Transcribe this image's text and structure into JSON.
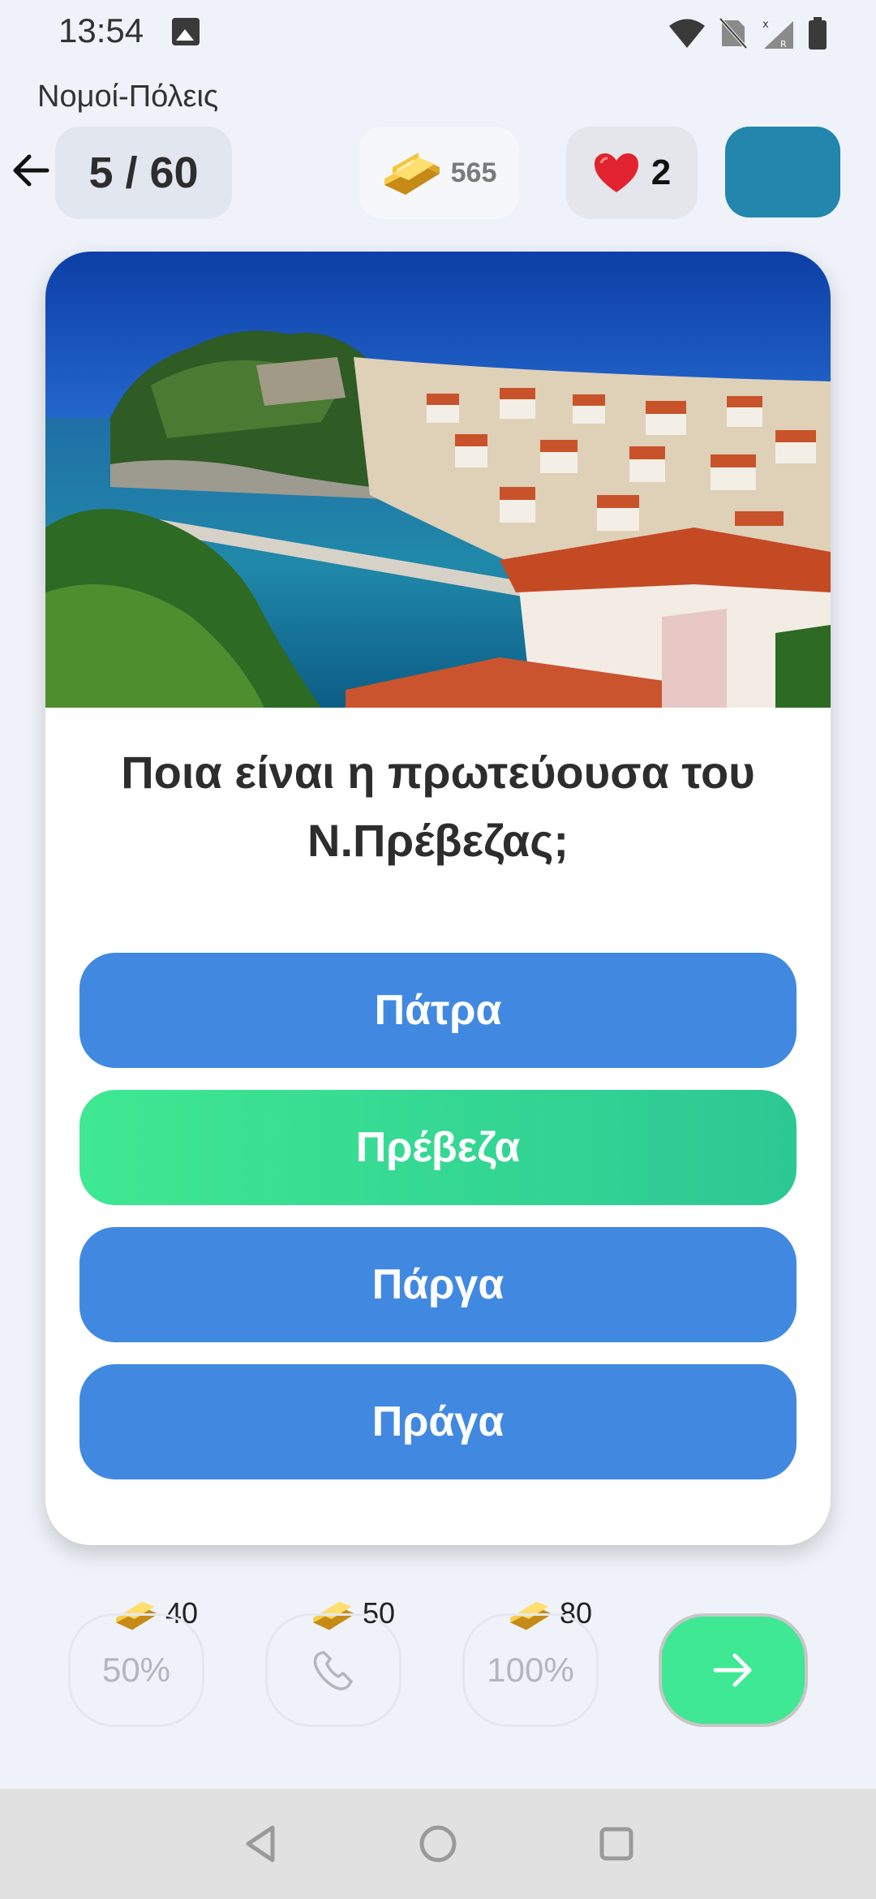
{
  "status_bar": {
    "time": "13:54"
  },
  "header": {
    "subtitle": "Νομοί-Πόλεις",
    "progress": "5 / 60",
    "coins": "565",
    "lives": "2"
  },
  "question": {
    "text": "Ποια είναι η πρωτεύουσα του Ν.Πρέβεζας;"
  },
  "answers": [
    {
      "label": "Πάτρα",
      "state": "default"
    },
    {
      "label": "Πρέβεζα",
      "state": "correct"
    },
    {
      "label": "Πάργα",
      "state": "default"
    },
    {
      "label": "Πράγα",
      "state": "default"
    }
  ],
  "lifelines": [
    {
      "label": "50%",
      "cost": "40",
      "icon": "fifty-fifty"
    },
    {
      "label": "",
      "cost": "50",
      "icon": "phone-icon"
    },
    {
      "label": "100%",
      "cost": "80",
      "icon": "hundred-percent"
    }
  ],
  "colors": {
    "answer_default": "#4189e0",
    "answer_correct": "#3fe892",
    "accent_box": "#2286ad",
    "next_button": "#3fe892"
  }
}
